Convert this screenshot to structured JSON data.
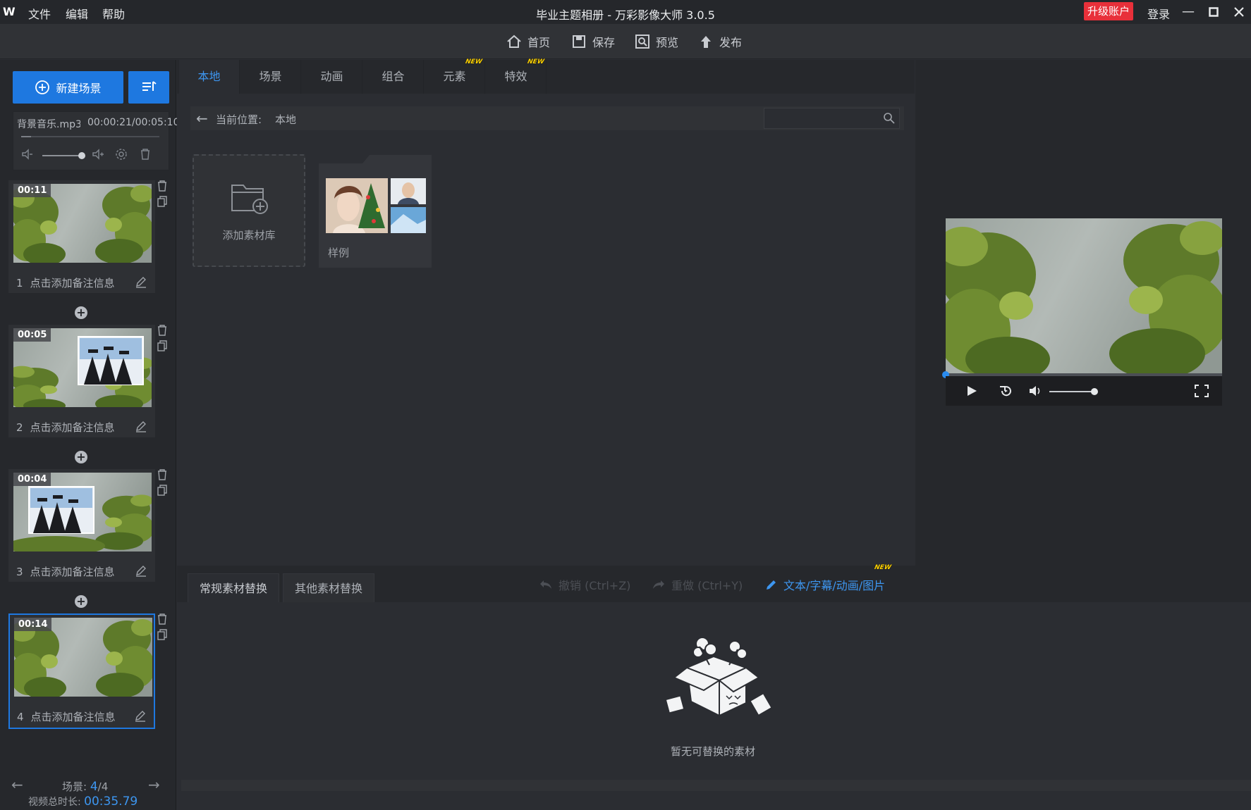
{
  "titlebar": {
    "logo": "W",
    "menus": [
      "文件",
      "编辑",
      "帮助"
    ],
    "title": "毕业主题相册 - 万彩影像大师 3.0.5",
    "upgrade": "升级账户",
    "login": "登录"
  },
  "toolbar": {
    "home": "首页",
    "save": "保存",
    "preview": "预览",
    "publish": "发布"
  },
  "left": {
    "new_scene": "新建场景",
    "music": {
      "name": "背景音乐.mp3",
      "time": "00:00:21/00:05:10",
      "progress": 0.07
    },
    "scenes": [
      {
        "num": "1",
        "time": "00:11",
        "note": "点击添加备注信息"
      },
      {
        "num": "2",
        "time": "00:05",
        "note": "点击添加备注信息"
      },
      {
        "num": "3",
        "time": "00:04",
        "note": "点击添加备注信息"
      },
      {
        "num": "4",
        "time": "00:14",
        "note": "点击添加备注信息"
      }
    ],
    "footer": {
      "scene_label": "场景:",
      "scene_current": "4",
      "scene_total": "/4",
      "duration_label": "视频总时长:",
      "duration": "00:35.79"
    }
  },
  "center": {
    "tabs": [
      "本地",
      "场景",
      "动画",
      "组合",
      "元素",
      "特效"
    ],
    "new_badge": "NEW",
    "path_label": "当前位置:",
    "path_value": "本地",
    "search_placeholder": "",
    "add_library": "添加素材库",
    "sample": "样例"
  },
  "bottom": {
    "tabs": [
      "常规素材替换",
      "其他素材替换"
    ],
    "undo": "撤销 (Ctrl+Z)",
    "redo": "重做 (Ctrl+Y)",
    "text_edit": "文本/字幕/动画/图片",
    "new_badge": "NEW",
    "empty": "暂无可替换的素材"
  },
  "colors": {
    "accent": "#1e78e0",
    "link": "#3d96f0",
    "upgrade": "#e8303a",
    "new_badge": "#ffd200"
  }
}
